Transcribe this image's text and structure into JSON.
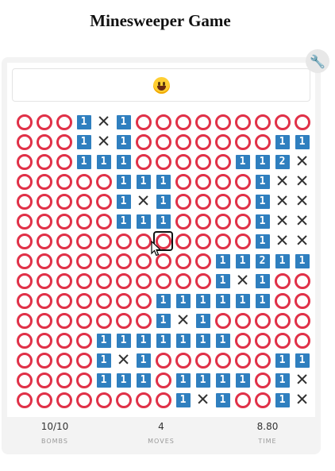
{
  "title": "Minesweeper Game",
  "board": {
    "rows": [
      "ooo1x1oooooooo o",
      "ooo1x1ooooooo11",
      "ooo111ooooo112x",
      "ooooo111oooo1xxx",
      "ooooo1x1oooo1xx",
      "ooooo111oooo1xx",
      "ooooooo oooo1xx",
      "oooooooooo11211",
      "oooooooooo1x1oo",
      "ooooooo111111oo",
      "ooooooo1x1ooooo",
      "oooo1111111oooo",
      "oooo1x1ooooooo11",
      "oooo111o1111o1x",
      "oooooooo1x1oo1x"
    ]
  },
  "focused_cell": {
    "row": 6,
    "col": 7
  },
  "stats": {
    "bombs": {
      "value": "10/10",
      "label": "BOMBS"
    },
    "moves": {
      "value": "4",
      "label": "MOVES"
    },
    "time": {
      "value": "8.80",
      "label": "TIME"
    }
  }
}
